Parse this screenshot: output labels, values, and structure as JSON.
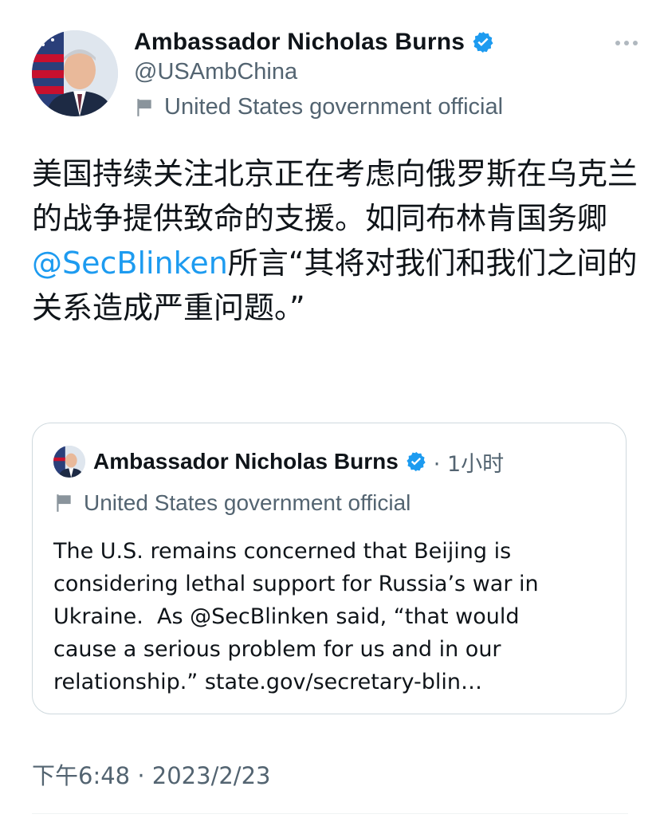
{
  "tweet": {
    "author": {
      "name": "Ambassador Nicholas Burns",
      "handle": "@USAmbChina",
      "label": "United States government official"
    },
    "text_parts": [
      "美国持续关注北京正在考虑向俄罗斯在乌克兰的战争提供致命的支援。如同布林肯国务卿",
      "@SecBlinken",
      "所言“其将对我们和我们之间的关系造成严重问题。”"
    ],
    "timestamp": "下午6:48 · 2023/2/23"
  },
  "quoted": {
    "name": "Ambassador Nicholas Burns",
    "time": "· 1小时",
    "label": "United States government official",
    "text": "The U.S. remains concerned that Beijing is\nconsidering lethal support for Russia’s war in\nUkraine.  As @SecBlinken said, “that would\ncause a serious problem for us and in our\nrelationship.” state.gov/secretary-blin…"
  },
  "colors": {
    "accent": "#1d9bf0",
    "secondary_text": "#536471",
    "border": "#cfd9de"
  },
  "icons": {
    "verified": "verified-badge-icon",
    "label": "government-flag-icon",
    "more": "more-options-icon"
  }
}
